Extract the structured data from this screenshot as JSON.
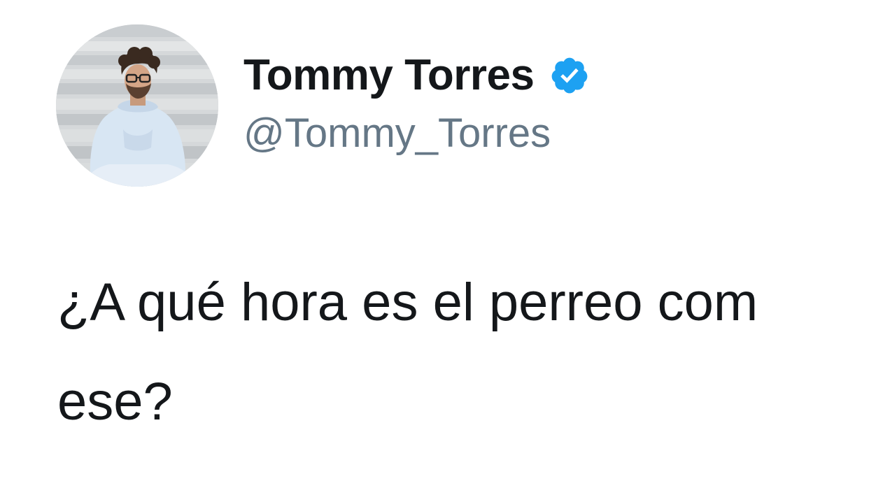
{
  "tweet": {
    "author": {
      "display_name": "Tommy Torres",
      "handle": "@Tommy_Torres",
      "verified": true,
      "verified_icon": "verified-badge-icon",
      "verified_color": "#1da1f2"
    },
    "text_line_1": "¿A qué hora es el perreo com",
    "text_line_2": "ese?"
  },
  "colors": {
    "name": "#14171a",
    "handle": "#657786",
    "text": "#14171a",
    "background": "#ffffff"
  }
}
